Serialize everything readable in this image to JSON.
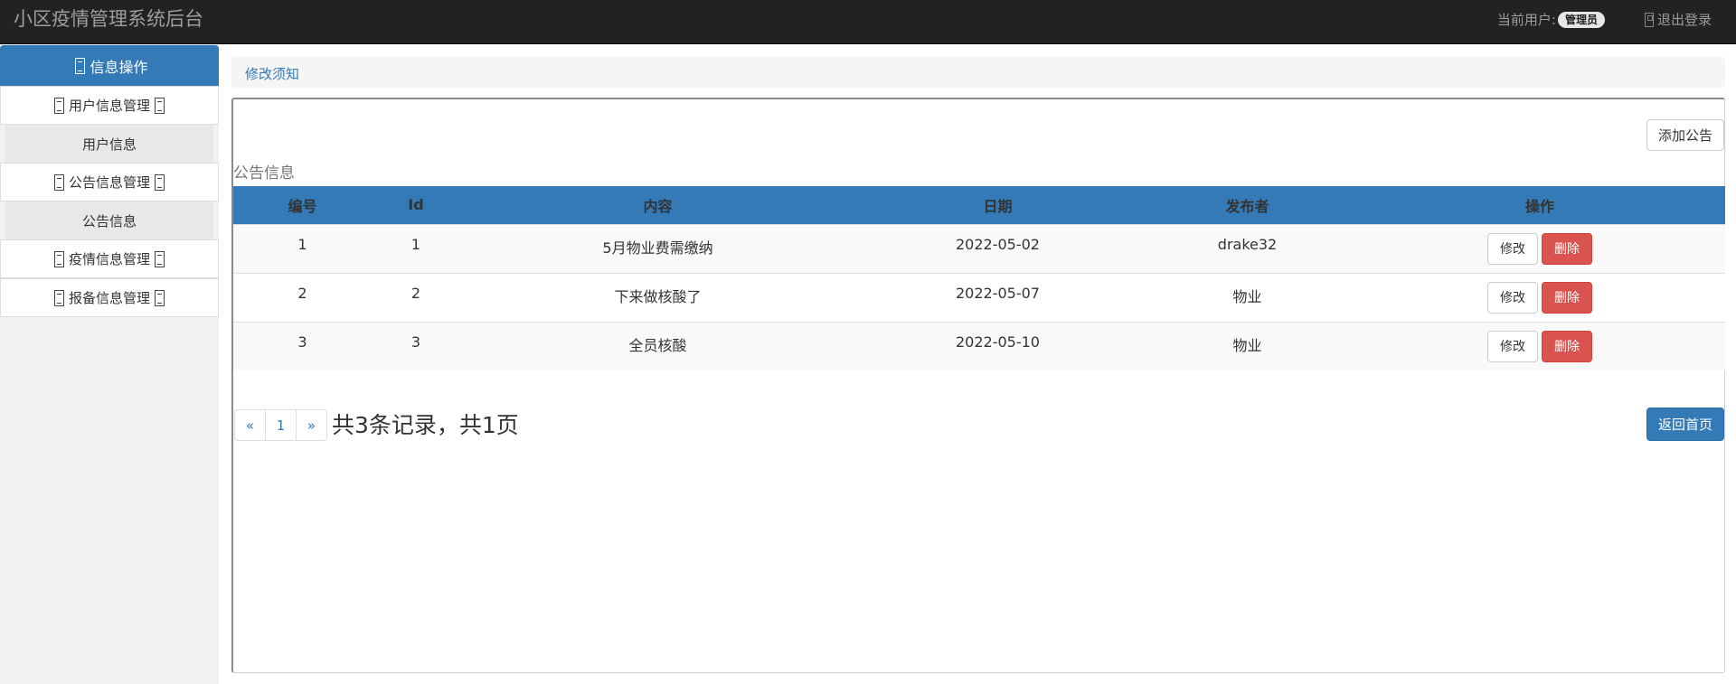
{
  "header": {
    "brand": "小区疫情管理系统后台",
    "current_user_label": "当前用户:",
    "current_user_badge": "管理员",
    "logout_label": "退出登录"
  },
  "sidebar": {
    "header": "信息操作",
    "items": [
      {
        "label": "用户信息管理",
        "type": "group"
      },
      {
        "label": "用户信息",
        "type": "sub"
      },
      {
        "label": "公告信息管理",
        "type": "group"
      },
      {
        "label": "公告信息",
        "type": "sub"
      },
      {
        "label": "疫情信息管理",
        "type": "group"
      },
      {
        "label": "报备信息管理",
        "type": "group"
      }
    ]
  },
  "breadcrumb": {
    "link": "修改须知"
  },
  "panel": {
    "add_button": "添加公告",
    "caption": "公告信息",
    "columns": [
      "编号",
      "Id",
      "内容",
      "日期",
      "发布者",
      "操作"
    ],
    "rows": [
      {
        "no": "1",
        "id": "1",
        "content": "5月物业费需缴纳",
        "date": "2022-05-02",
        "publisher": "drake32"
      },
      {
        "no": "2",
        "id": "2",
        "content": "下来做核酸了",
        "date": "2022-05-07",
        "publisher": "物业"
      },
      {
        "no": "3",
        "id": "3",
        "content": "全员核酸",
        "date": "2022-05-10",
        "publisher": "物业"
      }
    ],
    "edit_label": "修改",
    "delete_label": "删除",
    "pagination": {
      "prev": "«",
      "page": "1",
      "next": "»"
    },
    "records_text": "共3条记录，共1页",
    "home_button": "返回首页"
  },
  "colors": {
    "primary": "#337ab7",
    "danger": "#d9534f",
    "navbar": "#222222"
  }
}
